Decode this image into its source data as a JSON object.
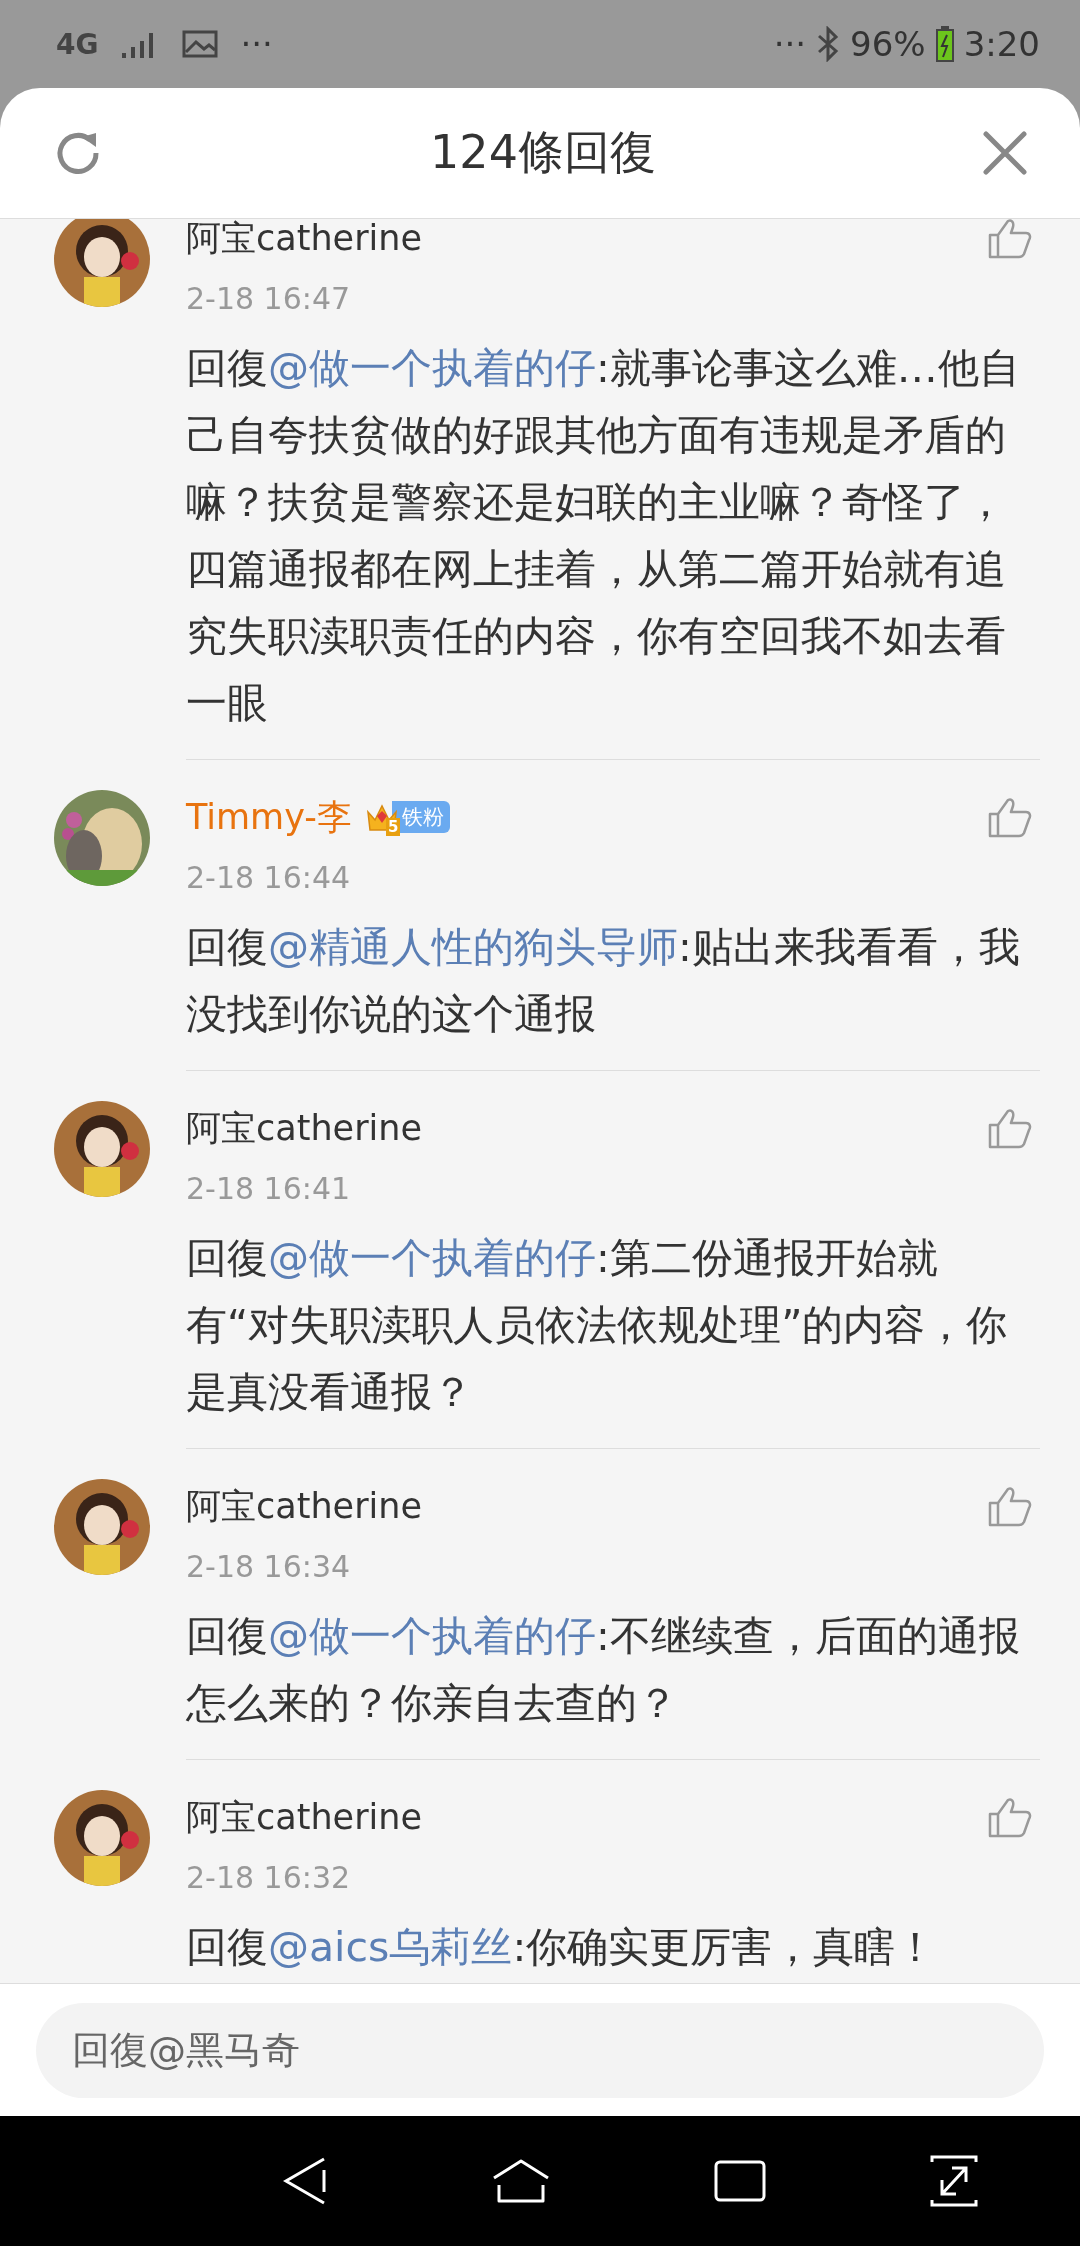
{
  "status_bar": {
    "network": "4G",
    "left_more": "···",
    "right_more": "···",
    "battery": "96%",
    "time": "3:20"
  },
  "header": {
    "title": "124條回復"
  },
  "comments": [
    {
      "name": "阿宝catherine",
      "time": "2-18 16:47",
      "prefix": "回復",
      "mention": "@做一个执着的仔",
      "body": ":就事论事这么难…他自己自夸扶贫做的好跟其他方面有违规是矛盾的嘛？扶贫是警察还是妇联的主业嘛？奇怪了，四篇通报都在网上挂着，从第二篇开始就有追究失职渎职责任的内容，你有空回我不如去看一眼"
    },
    {
      "name": "Timmy-李",
      "color": "#e8730f",
      "badge": {
        "level": "5",
        "label": "铁粉"
      },
      "time": "2-18 16:44",
      "prefix": "回復",
      "mention": "@精通人性的狗头导师",
      "body": ":贴出来我看看，我没找到你说的这个通报"
    },
    {
      "name": "阿宝catherine",
      "time": "2-18 16:41",
      "prefix": "回復",
      "mention": "@做一个执着的仔",
      "body": ":第二份通报开始就有“对失职渎职人员依法依规处理”的内容，你是真没看通报？"
    },
    {
      "name": "阿宝catherine",
      "time": "2-18 16:34",
      "prefix": "回復",
      "mention": "@做一个执着的仔",
      "body": ":不继续查，后面的通报怎么来的？你亲自去查的？"
    },
    {
      "name": "阿宝catherine",
      "time": "2-18 16:32",
      "prefix": "回復",
      "mention": "@aics乌莉丝",
      "body": ":你确实更厉害，真瞎！"
    }
  ],
  "reply_field": {
    "placeholder": "回復@黑马奇"
  }
}
